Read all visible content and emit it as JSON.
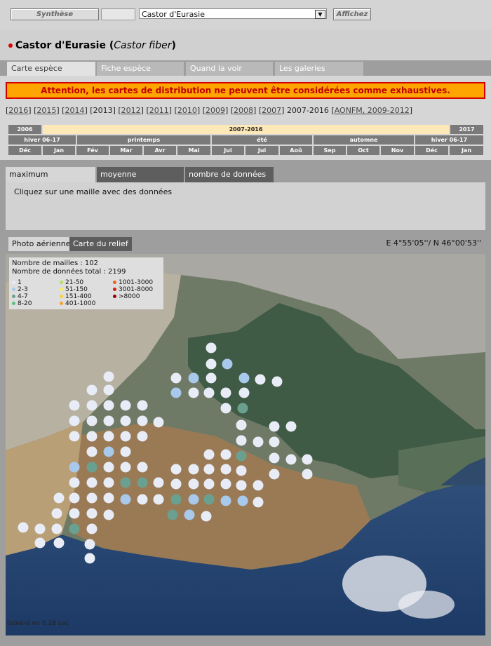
{
  "topbar": {
    "synthese_label": "Synthèse",
    "species_select": "Castor d'Eurasie",
    "afficher_label": "Affichez"
  },
  "header": {
    "common_name": "Castor d'Eurasie",
    "latin_name": "Castor fiber"
  },
  "tabs": [
    "Carte espèce",
    "Fiche espèce",
    "Quand la voir",
    "Les galeries"
  ],
  "warning": "Attention, les cartes de distribution ne peuvent être considérées comme exhaustives.",
  "years": {
    "links": [
      "2016",
      "2015",
      "2014"
    ],
    "plain": "2013",
    "links2": [
      "2012",
      "2011",
      "2010",
      "2009",
      "2008",
      "2007"
    ],
    "current": "2007-2016",
    "aonfm": "AONFM, 2009-2012"
  },
  "calendar": {
    "years_row": [
      "2006",
      "2007-2016",
      "2017"
    ],
    "seasons_row": [
      "hiver 06-17",
      "printemps",
      "été",
      "automne",
      "hiver 06-17"
    ],
    "months_row": [
      "Déc",
      "Jan",
      "Fév",
      "Mar",
      "Avr",
      "Mai",
      "Jui",
      "Jui",
      "Aoû",
      "Sep",
      "Oct",
      "Nov",
      "Déc",
      "Jan"
    ]
  },
  "subtabs": [
    "maximum",
    "moyenne",
    "nombre de données"
  ],
  "info_text": "Cliquez sur une maille avec des données",
  "map_tabs": [
    "Photo aérienne",
    "Carte du relief"
  ],
  "coordinates": "E 4°55'05''/ N 46°00'53''",
  "legend": {
    "mailles": "Nombre de mailles : 102",
    "total": "Nombre de données total : 2199",
    "classes": [
      {
        "label": "1",
        "color": "#e8ecf6"
      },
      {
        "label": "2-3",
        "color": "#a8c8ec"
      },
      {
        "label": "4-7",
        "color": "#6aa090"
      },
      {
        "label": "8-20",
        "color": "#5cc080"
      },
      {
        "label": "21-50",
        "color": "#b8e060"
      },
      {
        "label": "51-150",
        "color": "#f8f060"
      },
      {
        "label": "151-400",
        "color": "#f8d040"
      },
      {
        "label": "401-1000",
        "color": "#f8a030"
      },
      {
        "label": "1001-3000",
        "color": "#f06020"
      },
      {
        "label": "3001-8000",
        "color": "#d02010"
      },
      {
        "label": ">8000",
        "color": "#900000"
      }
    ]
  },
  "generated": "Généré en 0.28 sec"
}
